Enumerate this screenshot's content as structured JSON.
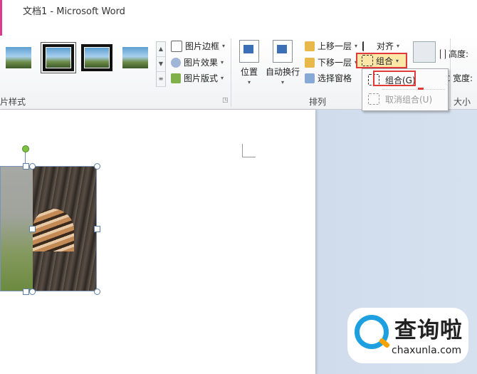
{
  "window": {
    "title": "文档1 - Microsoft Word"
  },
  "ribbon": {
    "picture_styles": {
      "label": "片样式",
      "commands": [
        "图片边框",
        "图片效果",
        "图片版式"
      ]
    },
    "arrange": {
      "label": "排列",
      "position": "位置",
      "wrap_text": "自动换行",
      "bring_forward": "上移一层",
      "send_backward": "下移一层",
      "selection_pane": "选择窗格",
      "align": "对齐",
      "group": "组合"
    },
    "size": {
      "label": "大小",
      "height": "高度:",
      "width": "宽度:"
    }
  },
  "group_menu": {
    "items": [
      {
        "label": "组合(G)",
        "enabled": true
      },
      {
        "label": "取消组合(U)",
        "enabled": false
      }
    ]
  },
  "watermark": {
    "text": "查询啦",
    "url": "chaxunla.com"
  },
  "colors": {
    "accent_red": "#e03a3a",
    "title_pink": "#e03a8c",
    "watermark_blue": "#1e9fe0"
  }
}
